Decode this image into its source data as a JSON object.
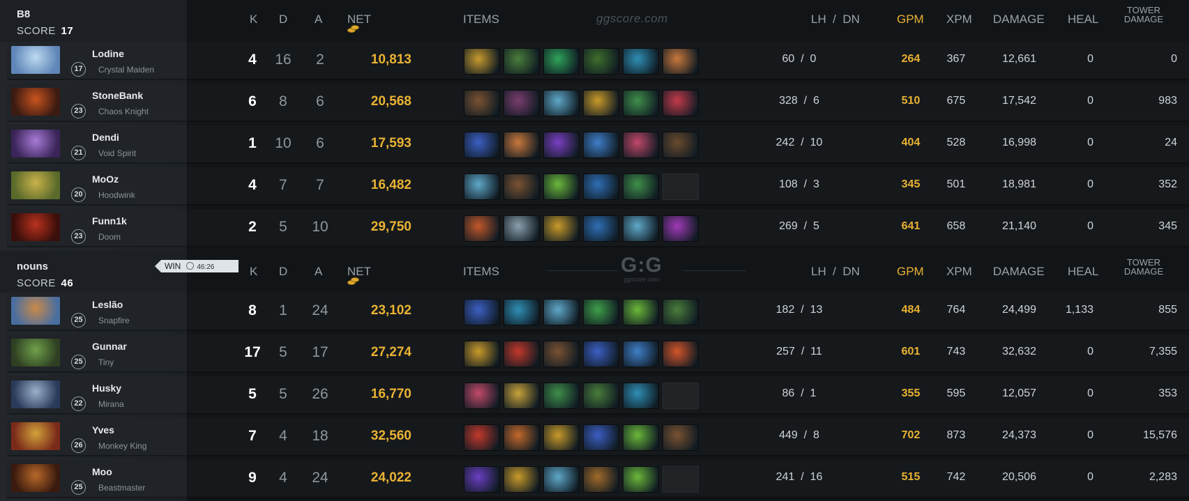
{
  "headers": {
    "k": "K",
    "d": "D",
    "a": "A",
    "net": "NET",
    "items": "ITEMS",
    "lhdn": "LH  /  DN",
    "gpm": "GPM",
    "xpm": "XPM",
    "damage": "DAMAGE",
    "heal": "HEAL",
    "tower1": "TOWER",
    "tower2": "DAMAGE"
  },
  "watermark_text": "ggscore.com",
  "watermark_logo": "G:G",
  "watermark_logo_sub": "ggscore.com",
  "result": {
    "label": "WIN",
    "time": "46:26"
  },
  "teams": [
    {
      "name": "B8",
      "score_label": "SCORE",
      "score": "17",
      "players": [
        {
          "name": "Lodine",
          "level": "17",
          "hero": "Crystal Maiden",
          "k": "4",
          "d": "16",
          "a": "2",
          "net": "10,813",
          "lh_dn": "60  /  0",
          "gpm": "264",
          "xpm": "367",
          "damage": "12,661",
          "heal": "0",
          "tower": "0",
          "avatar_colors": [
            "#bcd9f0",
            "#5f86b8"
          ],
          "items": [
            "#c79a2e",
            "#4a7d3b",
            "#2fa35a",
            "#3e6e2c",
            "#2f8fb5",
            "#c9783c"
          ]
        },
        {
          "name": "StoneBank",
          "level": "23",
          "hero": "Chaos Knight",
          "k": "6",
          "d": "8",
          "a": "6",
          "net": "20,568",
          "lh_dn": "328  /  6",
          "gpm": "510",
          "xpm": "675",
          "damage": "17,542",
          "heal": "0",
          "tower": "983",
          "avatar_colors": [
            "#c8541e",
            "#3b1a12"
          ],
          "items": [
            "#7a5232",
            "#7a3d6e",
            "#5fa8c9",
            "#c99a2a",
            "#3f8f4a",
            "#c23a4a"
          ]
        },
        {
          "name": "Dendi",
          "level": "21",
          "hero": "Void Spirit",
          "k": "1",
          "d": "10",
          "a": "6",
          "net": "17,593",
          "lh_dn": "242  /  10",
          "gpm": "404",
          "xpm": "528",
          "damage": "16,998",
          "heal": "0",
          "tower": "24",
          "avatar_colors": [
            "#a77bd6",
            "#3a2458"
          ],
          "items": [
            "#3c5fc4",
            "#c9783c",
            "#7a3fc2",
            "#3f7fc9",
            "#c2486a",
            "#6a4a2e"
          ]
        },
        {
          "name": "MoOz",
          "level": "20",
          "hero": "Hoodwink",
          "k": "4",
          "d": "7",
          "a": "7",
          "net": "16,482",
          "lh_dn": "108  /  3",
          "gpm": "345",
          "xpm": "501",
          "damage": "18,981",
          "heal": "0",
          "tower": "352",
          "avatar_colors": [
            "#c9b24a",
            "#5a6a2a"
          ],
          "items": [
            "#5fa8c9",
            "#7a5232",
            "#6ab83a",
            "#2f6fb5",
            "#3f8f4a",
            "empty"
          ]
        },
        {
          "name": "Funn1k",
          "level": "23",
          "hero": "Doom",
          "k": "2",
          "d": "5",
          "a": "10",
          "net": "29,750",
          "lh_dn": "269  /  5",
          "gpm": "641",
          "xpm": "658",
          "damage": "21,140",
          "heal": "0",
          "tower": "345",
          "avatar_colors": [
            "#b8321e",
            "#3a0e0a"
          ],
          "items": [
            "#c2582a",
            "#8aa0ad",
            "#c99a2a",
            "#2f6fb5",
            "#5fa8c9",
            "#a03ab8"
          ]
        }
      ]
    },
    {
      "name": "nouns",
      "score_label": "SCORE",
      "score": "46",
      "players": [
        {
          "name": "Leslão",
          "level": "25",
          "hero": "Snapfire",
          "k": "8",
          "d": "1",
          "a": "24",
          "net": "23,102",
          "lh_dn": "182  /  13",
          "gpm": "484",
          "xpm": "764",
          "damage": "24,499",
          "heal": "1,133",
          "tower": "855",
          "avatar_colors": [
            "#c98a4a",
            "#4a6ea0"
          ],
          "items": [
            "#3c5fc4",
            "#2f8fb5",
            "#5fa8c9",
            "#3fa04a",
            "#6ab83a",
            "#4a7d3b"
          ]
        },
        {
          "name": "Gunnar",
          "level": "25",
          "hero": "Tiny",
          "k": "17",
          "d": "5",
          "a": "17",
          "net": "27,274",
          "lh_dn": "257  /  11",
          "gpm": "601",
          "xpm": "743",
          "damage": "32,632",
          "heal": "0",
          "tower": "7,355",
          "avatar_colors": [
            "#6fa04a",
            "#2e3f22"
          ],
          "items": [
            "#c99a2a",
            "#c2382a",
            "#7a5232",
            "#3c5fc4",
            "#3f7fc9",
            "#d2542a"
          ]
        },
        {
          "name": "Husky",
          "level": "22",
          "hero": "Mirana",
          "k": "5",
          "d": "5",
          "a": "26",
          "net": "16,770",
          "lh_dn": "86  /  1",
          "gpm": "355",
          "xpm": "595",
          "damage": "12,057",
          "heal": "0",
          "tower": "353",
          "avatar_colors": [
            "#9ab0c9",
            "#2a3a5a"
          ],
          "items": [
            "#c24a6a",
            "#c9a23a",
            "#3f8f4a",
            "#4a7d3b",
            "#2f8fb5",
            "empty"
          ]
        },
        {
          "name": "Yves",
          "level": "26",
          "hero": "Monkey King",
          "k": "7",
          "d": "4",
          "a": "18",
          "net": "32,560",
          "lh_dn": "449  /  8",
          "gpm": "702",
          "xpm": "873",
          "damage": "24,373",
          "heal": "0",
          "tower": "15,576",
          "avatar_colors": [
            "#d2a23a",
            "#7a2a1a"
          ],
          "items": [
            "#c2382a",
            "#c2682a",
            "#c99a2a",
            "#3c5fc4",
            "#6ab83a",
            "#7a5232"
          ]
        },
        {
          "name": "Moo",
          "level": "25",
          "hero": "Beastmaster",
          "k": "9",
          "d": "4",
          "a": "24",
          "net": "24,022",
          "lh_dn": "241  /  16",
          "gpm": "515",
          "xpm": "742",
          "damage": "20,506",
          "heal": "0",
          "tower": "2,283",
          "avatar_colors": [
            "#b8682a",
            "#3a1a0e"
          ],
          "items": [
            "#6a3fc2",
            "#c99a2a",
            "#5fa8c9",
            "#a06a2a",
            "#6ab83a",
            "empty"
          ]
        }
      ]
    }
  ]
}
